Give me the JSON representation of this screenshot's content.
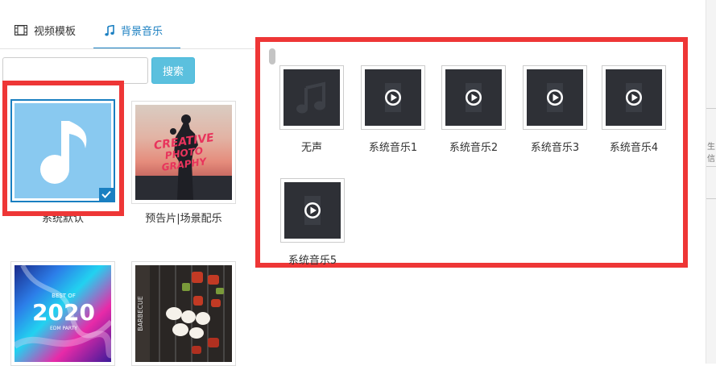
{
  "tabs": {
    "video_templates": "视频模板",
    "background_music": "背景音乐"
  },
  "search": {
    "value": "",
    "placeholder": "",
    "button_label": "搜索"
  },
  "albums": [
    {
      "label": "系统默认",
      "selected": true
    },
    {
      "label": "预告片|场景配乐"
    },
    {
      "label": "",
      "cover_text": "2020"
    },
    {
      "label": "",
      "cover_text": "BARBECUE"
    }
  ],
  "album_cover_art": {
    "creative_line1": "CREATIVE",
    "creative_line2": "PHOTO",
    "creative_line3": "GRAPHY",
    "twenty_top": "BEST OF",
    "twenty_bottom": "EDM PARTY"
  },
  "tracks": [
    {
      "label": "无声",
      "icon": "music-note-icon"
    },
    {
      "label": "系统音乐1",
      "icon": "play-circle-icon"
    },
    {
      "label": "系统音乐2",
      "icon": "play-circle-icon"
    },
    {
      "label": "系统音乐3",
      "icon": "play-circle-icon"
    },
    {
      "label": "系统音乐4",
      "icon": "play-circle-icon"
    },
    {
      "label": "系统音乐5",
      "icon": "play-circle-icon"
    }
  ],
  "right_edge_text": "生信",
  "colors": {
    "accent": "#1a7fc1",
    "highlight": "#ee3636",
    "search_button": "#5bc0de",
    "tile_bg": "#2e3036",
    "default_album_bg": "#89c9f0"
  }
}
